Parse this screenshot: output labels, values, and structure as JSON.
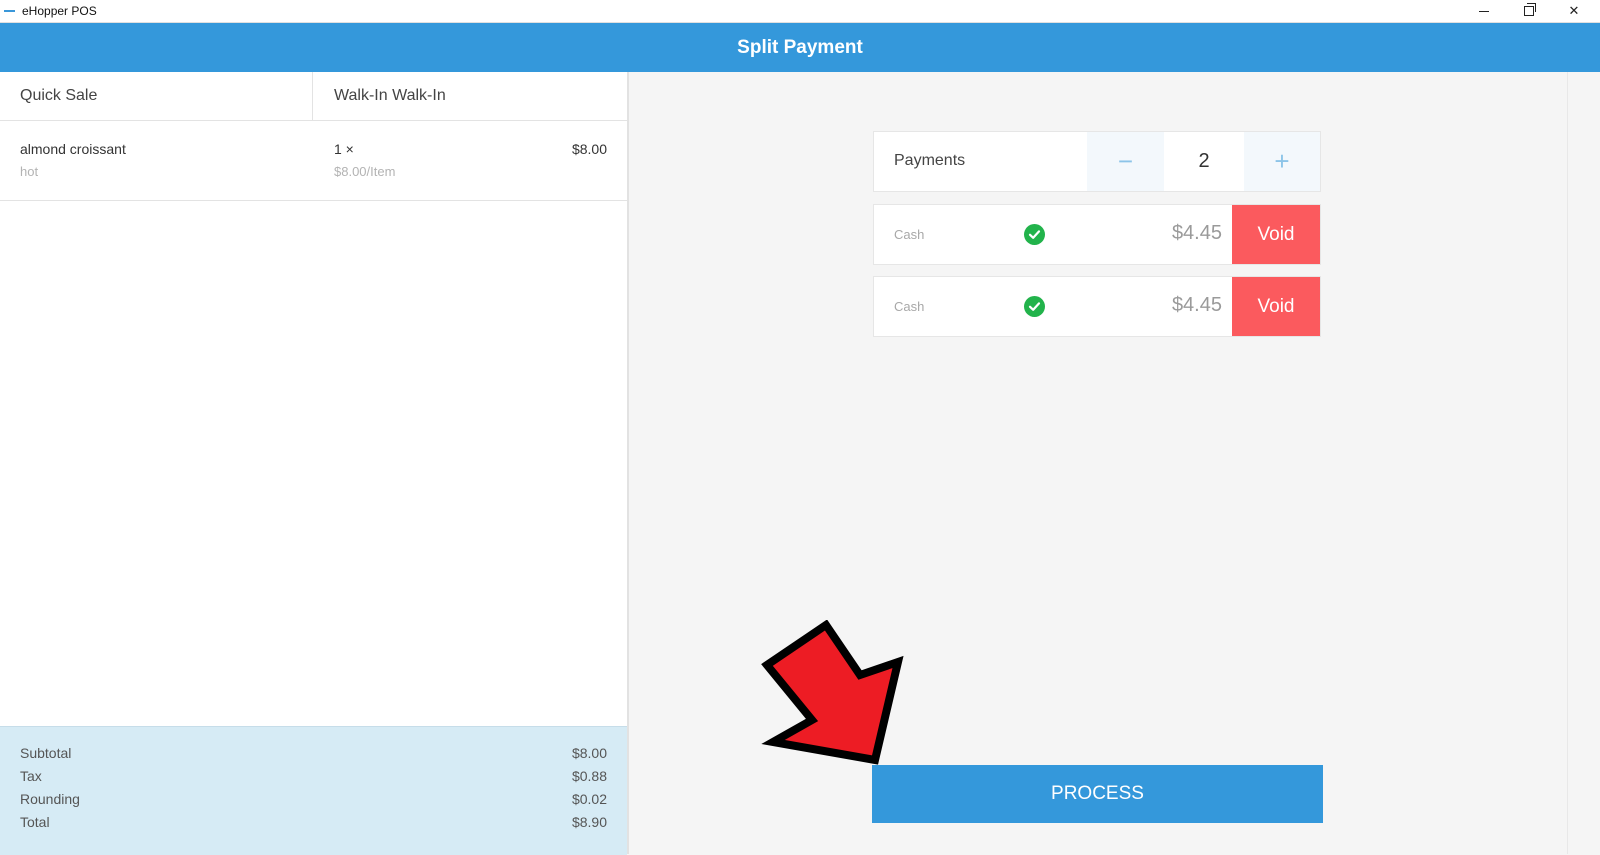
{
  "window": {
    "title": "eHopper POS",
    "controls": [
      "minimize-icon",
      "restore-icon",
      "close-icon"
    ]
  },
  "header": {
    "title": "Split Payment",
    "color": "#3498db"
  },
  "order": {
    "sale_type": "Quick Sale",
    "customer": "Walk-In Walk-In",
    "items": [
      {
        "name": "almond croissant",
        "modifier": "hot",
        "quantity": "1 ×",
        "unit_price": "$8.00/Item",
        "price": "$8.00"
      }
    ],
    "totals": [
      {
        "label": "Subtotal",
        "value": "$8.00"
      },
      {
        "label": "Tax",
        "value": "$0.88"
      },
      {
        "label": "Rounding",
        "value": "$0.02"
      },
      {
        "label": "Total",
        "value": "$8.90"
      }
    ]
  },
  "payments": {
    "label": "Payments",
    "count": "2",
    "minus_symbol": "−",
    "plus_symbol": "+",
    "lines": [
      {
        "method": "Cash",
        "amount": "$4.45",
        "void_label": "Void",
        "status_icon": "check-circle-icon"
      },
      {
        "method": "Cash",
        "amount": "$4.45",
        "void_label": "Void",
        "status_icon": "check-circle-icon"
      }
    ],
    "void_color": "#fb5a5e",
    "check_color": "#22b34b"
  },
  "process_button": {
    "label": "PROCESS"
  },
  "annotation": {
    "icon": "red-arrow-icon",
    "color": "#ed1c24"
  }
}
